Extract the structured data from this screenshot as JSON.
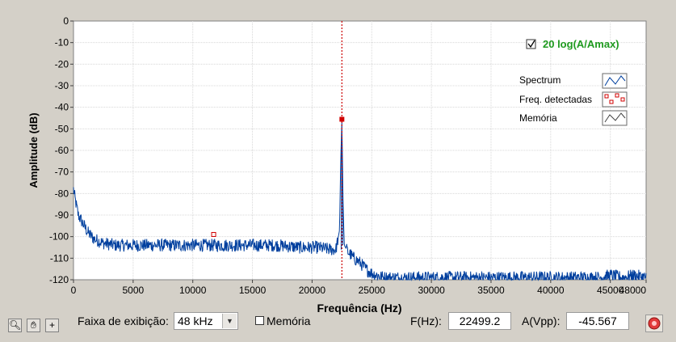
{
  "chart_data": {
    "type": "line",
    "title": "",
    "xlabel": "Frequência (Hz)",
    "ylabel": "Amplitude (dB)",
    "xlim": [
      0,
      48000
    ],
    "ylim": [
      -120,
      0
    ],
    "xticks": [
      "0",
      "5000",
      "10000",
      "15000",
      "20000",
      "25000",
      "30000",
      "35000",
      "40000",
      "45000",
      "48000"
    ],
    "yticks": [
      "0",
      "-10",
      "-20",
      "-30",
      "-40",
      "-50",
      "-60",
      "-70",
      "-80",
      "-90",
      "-100",
      "-110",
      "-120"
    ],
    "grid": true,
    "legend_position": "top-right",
    "legend_checkbox_label": "20 log(A/Amax)",
    "legend_checkbox_checked": true,
    "legend_entries": [
      "Spectrum",
      "Freq. detectadas",
      "Memória"
    ],
    "series": [
      {
        "name": "Spectrum",
        "color": "#003f9e",
        "x": [
          0,
          150,
          400,
          800,
          1200,
          1700,
          2500,
          3500,
          5000,
          7000,
          9000,
          11000,
          13000,
          15000,
          17000,
          19000,
          20500,
          21500,
          22000,
          22300,
          22400,
          22499.2,
          22600,
          22700,
          23000,
          23500,
          24000,
          24500,
          25000,
          26000,
          28000,
          30000,
          32000,
          34000,
          36000,
          38000,
          40000,
          42000,
          44000,
          45000,
          46000,
          47000,
          48000
        ],
        "y": [
          -78,
          -83,
          -90,
          -94,
          -98,
          -101,
          -103,
          -104,
          -104,
          -104,
          -104,
          -104,
          -104,
          -104,
          -104,
          -105,
          -105,
          -106,
          -106,
          -97,
          -65,
          -46,
          -85,
          -104,
          -107,
          -110,
          -112,
          -115,
          -117,
          -119,
          -119,
          -119,
          -119,
          -119,
          -119,
          -119,
          -119,
          -119,
          -119,
          -118,
          -119,
          -118,
          -119
        ]
      },
      {
        "name": "Freq. detectadas",
        "color": "#d00000",
        "points": [
          {
            "x": 22499.2,
            "y": -45.567
          },
          {
            "x": 11750,
            "y": -99
          }
        ]
      }
    ],
    "marker_line_x": 22499.2
  },
  "controls": {
    "range_label": "Faixa de exibição:",
    "range_value": "48 kHz",
    "memory_label": "Memória",
    "freq_label": "F(Hz):",
    "freq_value": "22499.2",
    "amp_label": "A(Vpp):",
    "amp_value": "-45.567"
  },
  "icons": [
    "zoom-icon",
    "pan-hand-icon",
    "crosshair-icon",
    "record-icon"
  ]
}
